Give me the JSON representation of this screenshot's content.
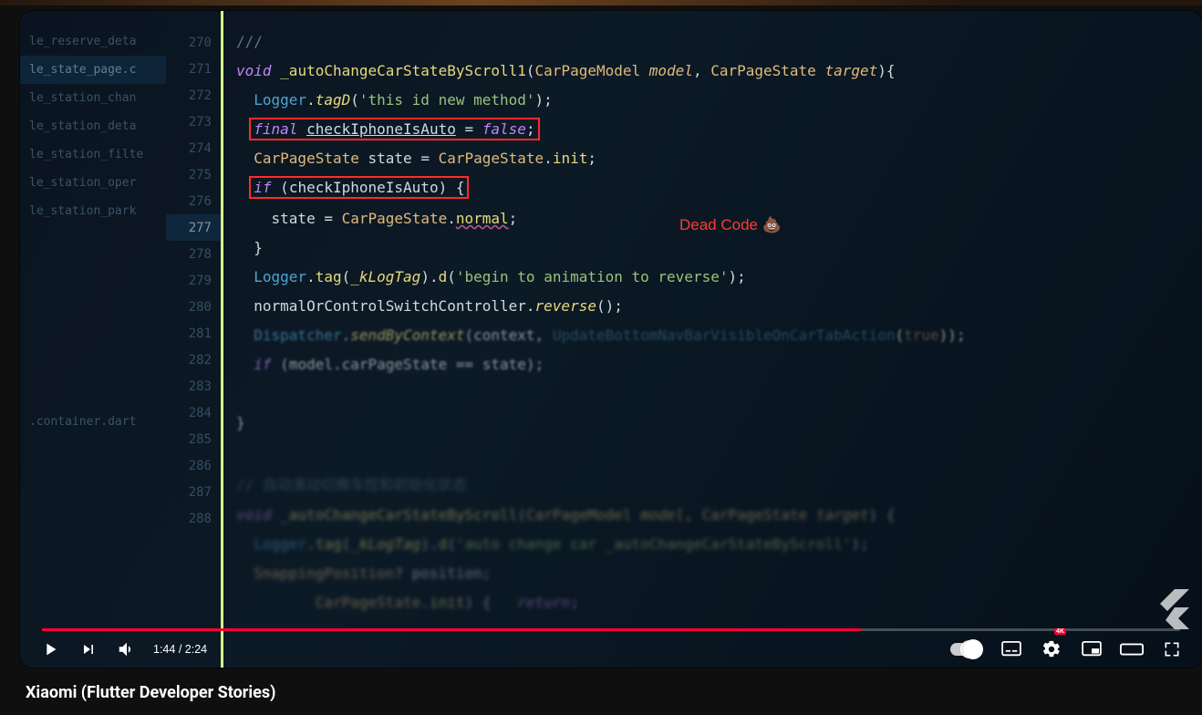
{
  "title": "Xiaomi (Flutter Developer Stories)",
  "player": {
    "current_time": "1:44",
    "duration": "2:24",
    "quality_badge": "4K",
    "progress_percent": 72
  },
  "annotation": {
    "label": "Dead Code 💩"
  },
  "file_tree": [
    "le_reserve_deta",
    "le_state_page.c",
    "le_station_chan",
    "le_station_deta",
    "le_station_filte",
    "le_station_oper",
    "le_station_park",
    "",
    ".container.dart"
  ],
  "file_tree_active_index": 1,
  "gutter": {
    "start": 270,
    "highlight": 277,
    "count": 19
  },
  "code": {
    "l270": "///",
    "l271_kw": "void",
    "l271_fn": "_autoChangeCarStateByScroll1",
    "l271_p1t": "CarPageModel",
    "l271_p1n": "model",
    "l271_p2t": "CarPageState",
    "l271_p2n": "target",
    "l271_tail": "){",
    "l272_obj": "Logger",
    "l272_fn": "tagD",
    "l272_str": "'this id new method'",
    "l273_kw": "final",
    "l273_var": "checkIphoneIsAuto",
    "l273_val": "false",
    "l274_t": "CarPageState",
    "l274_v": "state",
    "l274_r": "CarPageState",
    "l274_m": "init",
    "l275_kw": "if",
    "l275_cond": "checkIphoneIsAuto",
    "l277_l": "state",
    "l277_r": "CarPageState",
    "l277_m": "normal",
    "l278": "}",
    "l279_a": "Logger",
    "l279_b": "tag",
    "l279_c": "_kLogTag",
    "l279_d": "d",
    "l279_e": "'begin to animation to reverse'",
    "l280_a": "normalOrControlSwitchController",
    "l280_b": "reverse",
    "l281_a": "Dispatcher",
    "l281_b": "sendByContext",
    "l281_c": "context",
    "l281_d": "UpdateBottomNavBarVisibleOnCarTabAction",
    "l281_e": "true",
    "l282_kw": "if",
    "l282_a": "model",
    "l282_b": "carPageState",
    "l282_c": "state",
    "l284": "}",
    "l286_cmt": "// 自动滚动切换车控和初始化状态",
    "l287_kw": "void",
    "l287_fn": "_autoChangeCarStateByScroll",
    "l287_p1t": "CarPageModel",
    "l287_p1n": "model",
    "l287_p2t": "CarPageState",
    "l287_p2n": "target",
    "l287_tail": ") {",
    "l288_a": "Logger",
    "l288_b": "tag",
    "l288_c": "_kLogTag",
    "l288_d": "d",
    "l288_e": "'auto change car _autoChangeCarStateByScroll'",
    "l289_a": "SnappingPosition",
    "l289_b": "position",
    "l290_a": "CarPageState",
    "l290_b": "init",
    "l290_c": "return"
  }
}
